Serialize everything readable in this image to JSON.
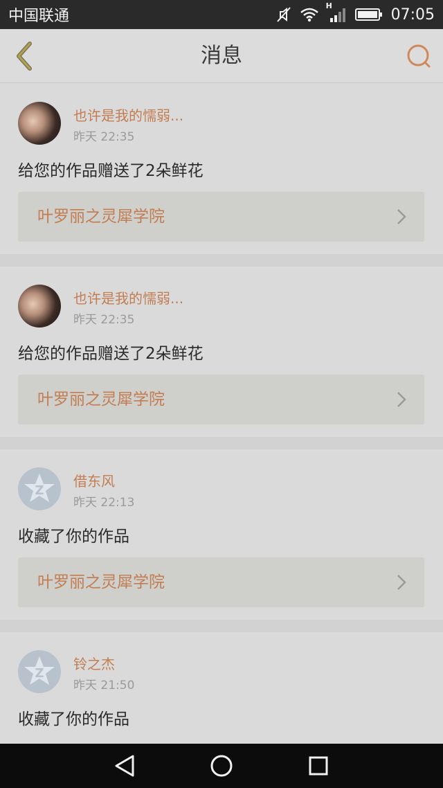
{
  "status_bar": {
    "carrier": "中国联通",
    "network_type": "H",
    "time": "07:05",
    "icons": [
      "mute-icon",
      "wifi-icon",
      "signal-icon",
      "battery-icon"
    ]
  },
  "header": {
    "title": "消息",
    "back_icon": "back-chevron-icon",
    "search_icon": "search-icon",
    "accent_color": "#c89a3f"
  },
  "messages": [
    {
      "user": "也许是我的懦弱...",
      "time": "昨天 22:35",
      "text": "给您的作品赠送了2朵鲜花",
      "work_title": "叶罗丽之灵犀学院",
      "avatar": "photo"
    },
    {
      "user": "也许是我的懦弱...",
      "time": "昨天 22:35",
      "text": "给您的作品赠送了2朵鲜花",
      "work_title": "叶罗丽之灵犀学院",
      "avatar": "photo"
    },
    {
      "user": "借东风",
      "time": "昨天 22:13",
      "text": "收藏了你的作品",
      "work_title": "叶罗丽之灵犀学院",
      "avatar": "default"
    },
    {
      "user": "铃之杰",
      "time": "昨天 21:50",
      "text": "收藏了你的作品",
      "work_title": "",
      "avatar": "default"
    }
  ],
  "nav_bar": {
    "icons": [
      "back-triangle-icon",
      "home-circle-icon",
      "recents-square-icon"
    ]
  },
  "colors": {
    "name_color": "#c27d52",
    "text_color": "#2a2a2a",
    "time_color": "#9a9a9a"
  }
}
